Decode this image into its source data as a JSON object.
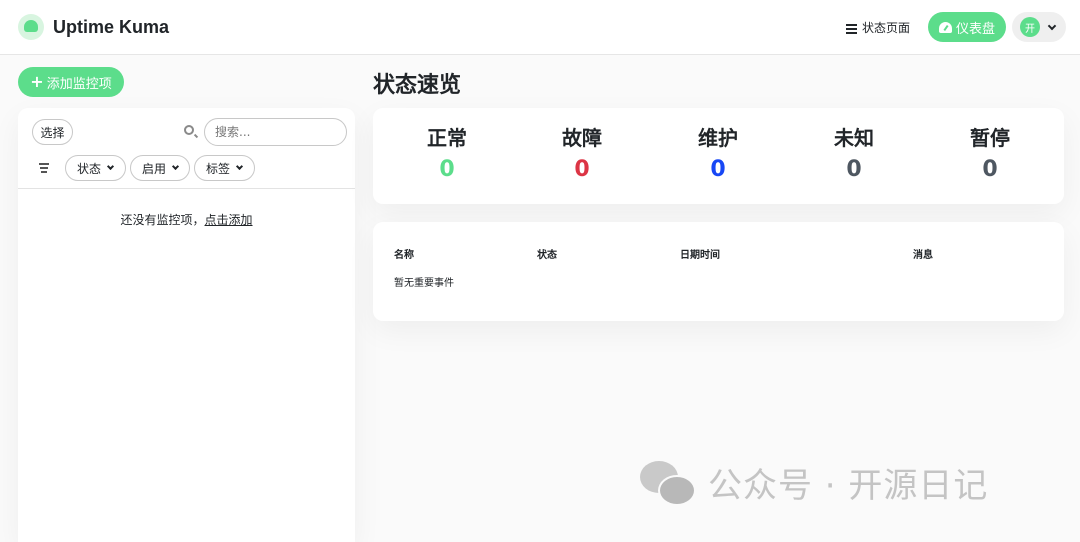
{
  "header": {
    "app_name": "Uptime Kuma",
    "status_page_label": "状态页面",
    "dashboard_label": "仪表盘",
    "avatar_text": "开"
  },
  "sidebar": {
    "add_monitor_label": "添加监控项",
    "select_label": "选择",
    "search_placeholder": "搜索...",
    "filters": [
      {
        "label": "状态"
      },
      {
        "label": "启用"
      },
      {
        "label": "标签"
      }
    ],
    "empty_text": "还没有监控项，",
    "empty_link": "点击添加"
  },
  "main": {
    "title": "状态速览",
    "stats": [
      {
        "label": "正常",
        "value": "0",
        "color": "#5cdd8b"
      },
      {
        "label": "故障",
        "value": "0",
        "color": "#dc3545"
      },
      {
        "label": "维护",
        "value": "0",
        "color": "#1747f5"
      },
      {
        "label": "未知",
        "value": "0",
        "color": "#4e5761"
      },
      {
        "label": "暂停",
        "value": "0",
        "color": "#4e5761"
      }
    ],
    "events": {
      "columns": [
        "名称",
        "状态",
        "日期时间",
        "消息"
      ],
      "empty_text": "暂无重要事件"
    }
  },
  "watermark": {
    "text": "公众号 · 开源日记"
  },
  "colors": {
    "accent": "#5cdd8b",
    "background": "#fafafa"
  }
}
